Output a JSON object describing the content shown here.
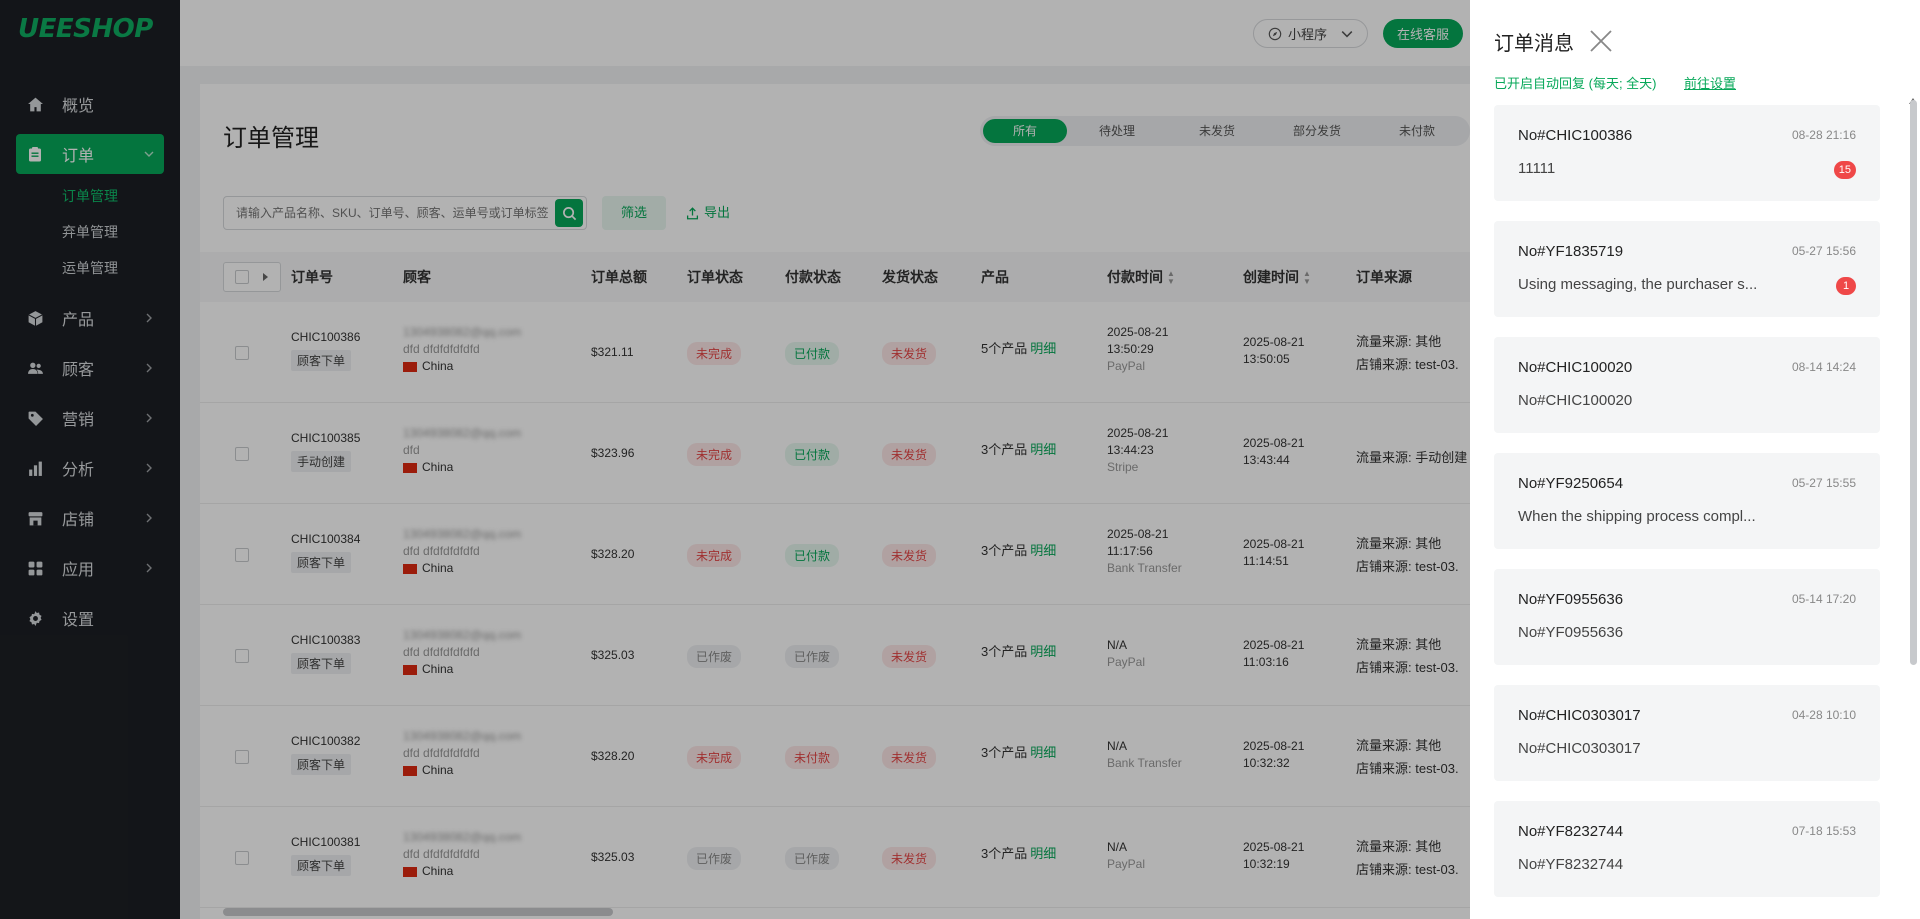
{
  "brand": {
    "logo": "UEESHOP"
  },
  "sidebar": {
    "items": [
      {
        "label": "概览",
        "icon": "home-icon"
      },
      {
        "label": "订单",
        "icon": "clipboard-icon",
        "active": true
      },
      {
        "label": "产品",
        "icon": "cube-icon"
      },
      {
        "label": "顾客",
        "icon": "users-icon"
      },
      {
        "label": "营销",
        "icon": "tag-icon"
      },
      {
        "label": "分析",
        "icon": "bar-chart-icon"
      },
      {
        "label": "店铺",
        "icon": "store-icon"
      },
      {
        "label": "应用",
        "icon": "apps-icon"
      },
      {
        "label": "设置",
        "icon": "gear-icon"
      }
    ],
    "sub_items": [
      "订单管理",
      "弃单管理",
      "运单管理"
    ]
  },
  "topbar": {
    "mini_program": "小程序",
    "online_service": "在线客服"
  },
  "page": {
    "title": "订单管理",
    "tabs": [
      "所有",
      "待处理",
      "未发货",
      "部分发货",
      "未付款"
    ],
    "search_placeholder": "请输入产品名称、SKU、订单号、顾客、运单号或订单标签",
    "filter_label": "筛选",
    "export_label": "导出"
  },
  "table": {
    "headers": [
      "订单号",
      "顾客",
      "订单总额",
      "订单状态",
      "付款状态",
      "发货状态",
      "产品",
      "付款时间",
      "创建时间",
      "订单来源"
    ],
    "rows": [
      {
        "order_no": "CHIC100386",
        "tag": "顾客下单",
        "email": "1304938082@qq.com",
        "name": "dfd dfdfdfdfdfd",
        "country": "China",
        "total": "$321.11",
        "order_status": "未完成",
        "pay_status": "已付款",
        "ship_status": "未发货",
        "products": "5个产品",
        "detail": "明细",
        "pay_date": "2025-08-21",
        "pay_time": "13:50:29",
        "pay_method": "PayPal",
        "create_date": "2025-08-21",
        "create_time": "13:50:05",
        "source1": "流量来源: 其他",
        "source2": "店铺来源: test-03."
      },
      {
        "order_no": "CHIC100385",
        "tag": "手动创建",
        "email": "1304938082@qq.com",
        "name": "dfd",
        "country": "China",
        "total": "$323.96",
        "order_status": "未完成",
        "pay_status": "已付款",
        "ship_status": "未发货",
        "products": "3个产品",
        "detail": "明细",
        "pay_date": "2025-08-21",
        "pay_time": "13:44:23",
        "pay_method": "Stripe",
        "create_date": "2025-08-21",
        "create_time": "13:43:44",
        "source1": "流量来源: 手动创建",
        "source2": ""
      },
      {
        "order_no": "CHIC100384",
        "tag": "顾客下单",
        "email": "1304938082@qq.com",
        "name": "dfd dfdfdfdfdfd",
        "country": "China",
        "total": "$328.20",
        "order_status": "未完成",
        "pay_status": "已付款",
        "ship_status": "未发货",
        "products": "3个产品",
        "detail": "明细",
        "pay_date": "2025-08-21",
        "pay_time": "11:17:56",
        "pay_method": "Bank Transfer",
        "create_date": "2025-08-21",
        "create_time": "11:14:51",
        "source1": "流量来源: 其他",
        "source2": "店铺来源: test-03."
      },
      {
        "order_no": "CHIC100383",
        "tag": "顾客下单",
        "email": "1304938082@qq.com",
        "name": "dfd dfdfdfdfdfd",
        "country": "China",
        "total": "$325.03",
        "order_status": "已作废",
        "pay_status": "已作废",
        "ship_status": "未发货",
        "products": "3个产品",
        "detail": "明细",
        "pay_date": "N/A",
        "pay_time": "",
        "pay_method": "PayPal",
        "create_date": "2025-08-21",
        "create_time": "11:03:16",
        "source1": "流量来源: 其他",
        "source2": "店铺来源: test-03."
      },
      {
        "order_no": "CHIC100382",
        "tag": "顾客下单",
        "email": "1304938082@qq.com",
        "name": "dfd dfdfdfdfdfd",
        "country": "China",
        "total": "$328.20",
        "order_status": "未完成",
        "pay_status": "未付款",
        "ship_status": "未发货",
        "products": "3个产品",
        "detail": "明细",
        "pay_date": "N/A",
        "pay_time": "",
        "pay_method": "Bank Transfer",
        "create_date": "2025-08-21",
        "create_time": "10:32:32",
        "source1": "流量来源: 其他",
        "source2": "店铺来源: test-03."
      },
      {
        "order_no": "CHIC100381",
        "tag": "顾客下单",
        "email": "1304938082@qq.com",
        "name": "dfd dfdfdfdfdfd",
        "country": "China",
        "total": "$325.03",
        "order_status": "已作废",
        "pay_status": "已作废",
        "ship_status": "未发货",
        "products": "3个产品",
        "detail": "明细",
        "pay_date": "N/A",
        "pay_time": "",
        "pay_method": "PayPal",
        "create_date": "2025-08-21",
        "create_time": "10:32:19",
        "source1": "流量来源: 其他",
        "source2": "店铺来源: test-03."
      }
    ]
  },
  "drawer": {
    "title": "订单消息",
    "auto_reply": "已开启自动回复 (每天; 全天)",
    "settings_link": "前往设置",
    "messages": [
      {
        "no": "No#CHIC100386",
        "time": "08-28 21:16",
        "text": "11111",
        "badge": "15"
      },
      {
        "no": "No#YF1835719",
        "time": "05-27 15:56",
        "text": "Using messaging, the purchaser s...",
        "badge": "1"
      },
      {
        "no": "No#CHIC100020",
        "time": "08-14 14:24",
        "text": "No#CHIC100020",
        "badge": ""
      },
      {
        "no": "No#YF9250654",
        "time": "05-27 15:55",
        "text": "When the shipping process compl...",
        "badge": ""
      },
      {
        "no": "No#YF0955636",
        "time": "05-14 17:20",
        "text": "No#YF0955636",
        "badge": ""
      },
      {
        "no": "No#CHIC0303017",
        "time": "04-28 10:10",
        "text": "No#CHIC0303017",
        "badge": ""
      },
      {
        "no": "No#YF8232744",
        "time": "07-18 15:53",
        "text": "No#YF8232744",
        "badge": ""
      }
    ]
  },
  "colors": {
    "accent": "#07a859",
    "sidebar_bg": "#1c1f24",
    "danger": "#e54545"
  }
}
